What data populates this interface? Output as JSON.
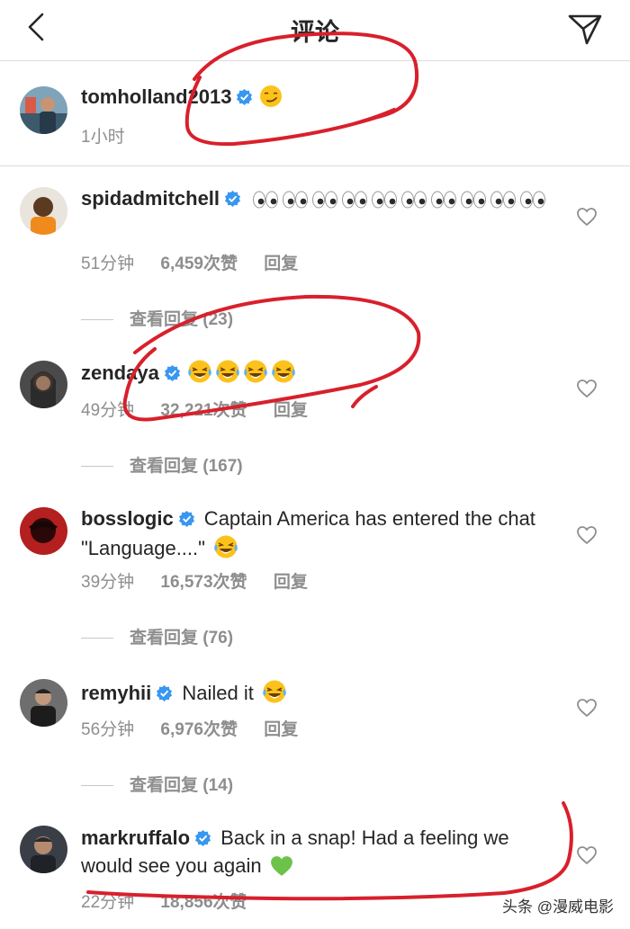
{
  "header": {
    "title": "评论"
  },
  "caption": {
    "username": "tomholland2013",
    "text": "",
    "time": "1小时"
  },
  "comments": [
    {
      "username": "spidadmitchell",
      "text": "",
      "time": "51分钟",
      "likes": "6,459次赞",
      "reply": "回复",
      "view_replies": "查看回复 (23)",
      "emoji": "eyes"
    },
    {
      "username": "zendaya",
      "text": "",
      "time": "49分钟",
      "likes": "32,221次赞",
      "reply": "回复",
      "view_replies": "查看回复 (167)",
      "emoji": "laughing-tears"
    },
    {
      "username": "bosslogic",
      "text": "Captain America has entered the chat \"Language....\"",
      "time": "39分钟",
      "likes": "16,573次赞",
      "reply": "回复",
      "view_replies": "查看回复 (76)",
      "emoji": "laughing-tears"
    },
    {
      "username": "remyhii",
      "text": "Nailed it",
      "time": "56分钟",
      "likes": "6,976次赞",
      "reply": "回复",
      "view_replies": "查看回复 (14)",
      "emoji": "laughing-tears"
    },
    {
      "username": "markruffalo",
      "text": "Back in a snap! Had a feeling we would see you again",
      "time": "22分钟",
      "likes": "18,856次赞",
      "reply": "回复",
      "emoji": "green-heart"
    }
  ],
  "watermark": "头条 @漫威电影",
  "colors": {
    "verified": "#3897f0",
    "annotation": "#d8202c",
    "meta": "#8e8e8e",
    "divider": "#dbdbdb"
  }
}
